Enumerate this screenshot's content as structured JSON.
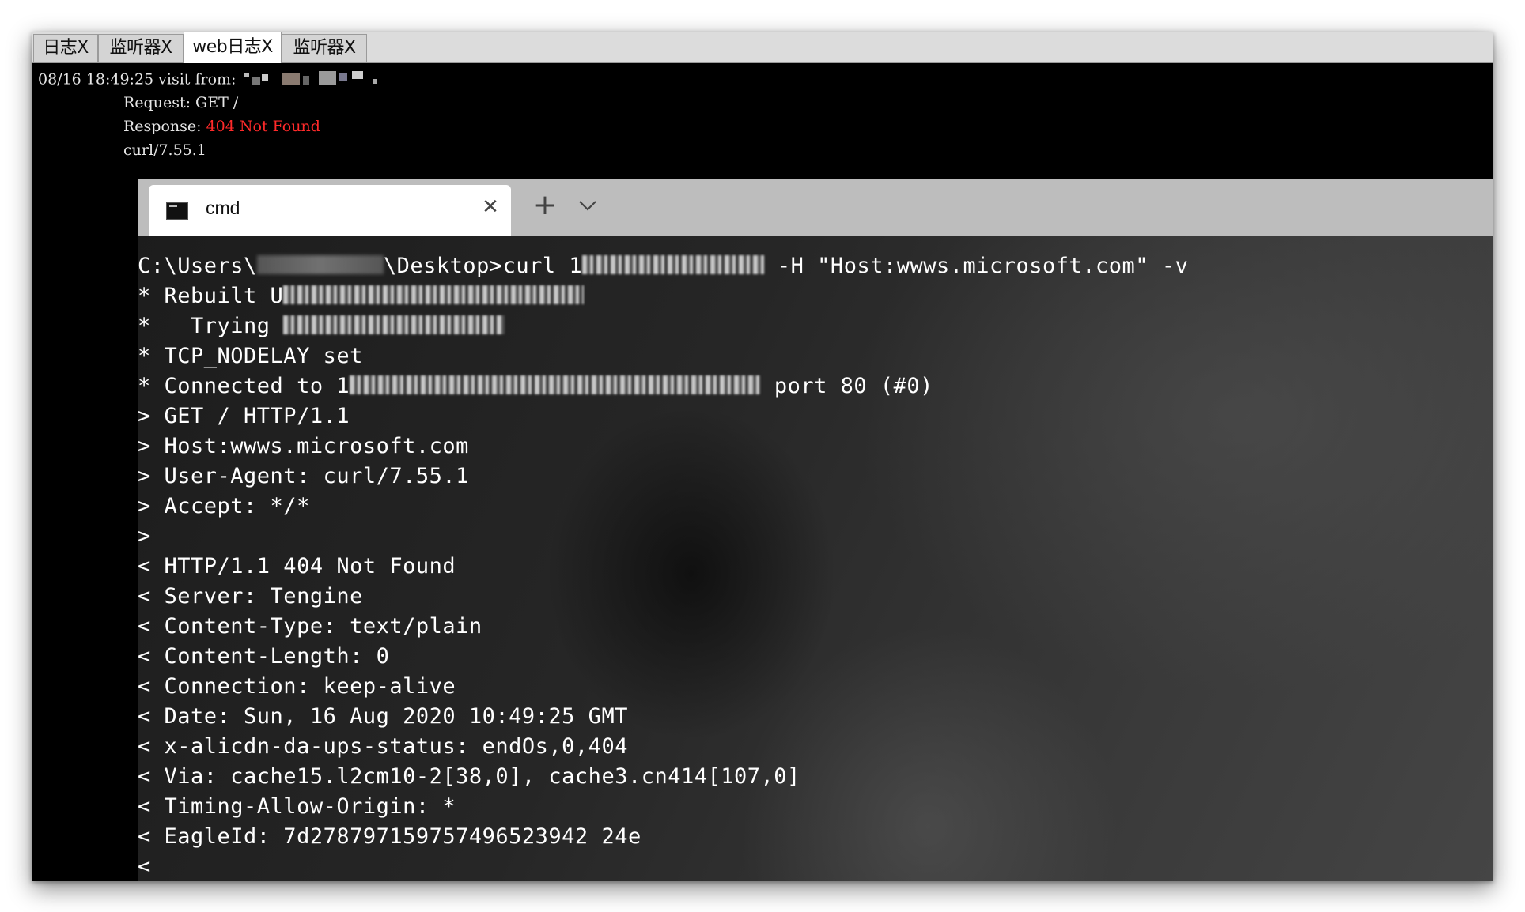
{
  "tabs": [
    {
      "label": "日志X"
    },
    {
      "label": "监听器X"
    },
    {
      "label": "web日志X"
    },
    {
      "label": "监听器X"
    }
  ],
  "log": {
    "line1": "08/16 18:49:25 visit from:",
    "request_label": "Request:",
    "request_value": "GET /",
    "response_label": "Response:",
    "response_value": "404 Not Found",
    "user_agent": "curl/7.55.1"
  },
  "cmd": {
    "tab_title": "cmd",
    "lines": [
      {
        "pre": "C:\\Users\\",
        "mid": "\\Desktop>curl 1",
        "post": " -H \"Host:wwws.microsoft.com\" -v"
      },
      {
        "pre": "* Rebuilt U"
      },
      {
        "pre": "*   Trying "
      },
      {
        "pre": "* TCP_NODELAY set"
      },
      {
        "pre": "* Connected to 1",
        "post": " port 80 (#0)"
      },
      {
        "pre": "> GET / HTTP/1.1"
      },
      {
        "pre": "> Host:wwws.microsoft.com"
      },
      {
        "pre": "> User-Agent: curl/7.55.1"
      },
      {
        "pre": "> Accept: */*"
      },
      {
        "pre": ">"
      },
      {
        "pre": "< HTTP/1.1 404 Not Found"
      },
      {
        "pre": "< Server: Tengine"
      },
      {
        "pre": "< Content-Type: text/plain"
      },
      {
        "pre": "< Content-Length: 0"
      },
      {
        "pre": "< Connection: keep-alive"
      },
      {
        "pre": "< Date: Sun, 16 Aug 2020 10:49:25 GMT"
      },
      {
        "pre": "< x-alicdn-da-ups-status: endOs,0,404"
      },
      {
        "pre": "< Via: cache15.l2cm10-2[38,0], cache3.cn414[107,0]"
      },
      {
        "pre": "< Timing-Allow-Origin: *"
      },
      {
        "pre": "< EagleId: 7d278797159757496523942 24e"
      },
      {
        "pre": "<"
      }
    ]
  }
}
